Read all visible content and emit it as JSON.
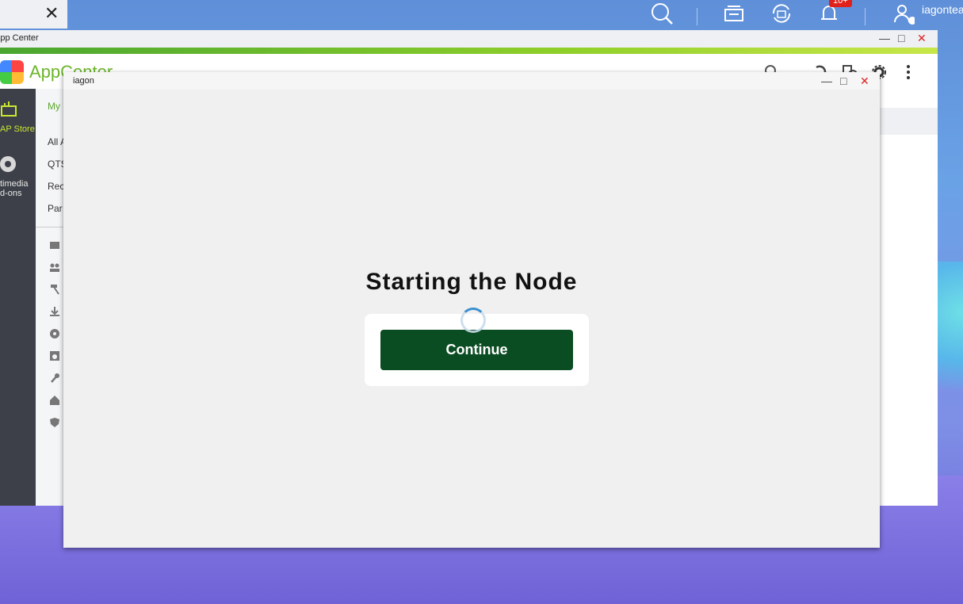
{
  "taskbar": {
    "notification_badge": "10+",
    "username": "iagontea",
    "icons": [
      "search-icon",
      "stack-icon",
      "sync-icon",
      "bell-icon",
      "user-icon"
    ]
  },
  "app_center": {
    "title": "App Center",
    "logo_text": "AppCenter",
    "sidebar": [
      {
        "label": "AP Store",
        "icon": "store-icon",
        "active": true
      },
      {
        "label": "timedia d-ons",
        "icon": "multimedia-icon",
        "active": false
      }
    ],
    "nav": [
      {
        "label": "My",
        "active": true
      },
      {
        "label": "All A",
        "active": false
      },
      {
        "label": "QTS",
        "active": false
      },
      {
        "label": "Reco",
        "active": false
      },
      {
        "label": "Par",
        "active": false
      }
    ],
    "category_icons": [
      "backup-icon",
      "users-icon",
      "hammer-icon",
      "download-icon",
      "film-icon",
      "camera-icon",
      "wrench-icon",
      "home-icon",
      "shield-icon"
    ],
    "accent_color": "#6bb52a"
  },
  "iagon": {
    "title": "iagon",
    "heading": "Starting the Node",
    "button_label": "Continue",
    "button_color": "#0b4d22"
  }
}
